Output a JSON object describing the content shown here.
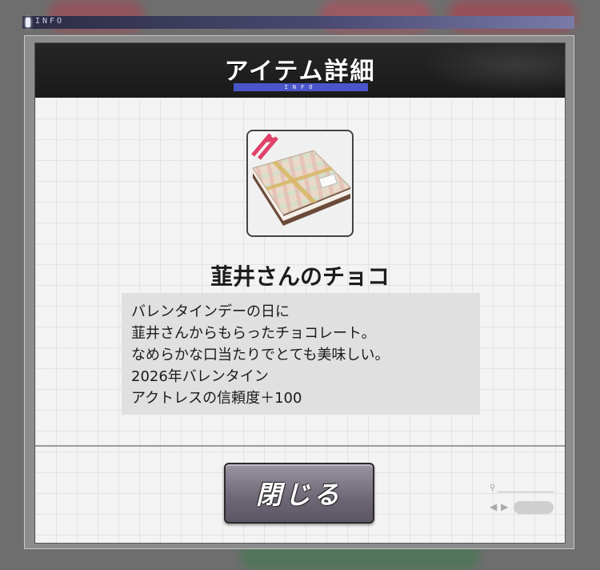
{
  "topbar": {
    "label": "INFO"
  },
  "dialog": {
    "title": "アイテム詳細",
    "subtitle": "INFO"
  },
  "item": {
    "icon": "chocolate-gift-box",
    "name": "韮井さんのチョコ",
    "description_lines": [
      "バレンタインデーの日に",
      "韮井さんからもらったチョコレート。",
      "なめらかな口当たりでとても美味しい。",
      "2026年バレンタイン",
      "アクトレスの信頼度＋100"
    ]
  },
  "close_button": {
    "label": "閉じる"
  },
  "colors": {
    "header_bg": "#1e1e1e",
    "accent_bar": "#4a56c8",
    "button_bg": "#7a7282",
    "ribbon": "#e0406a"
  }
}
